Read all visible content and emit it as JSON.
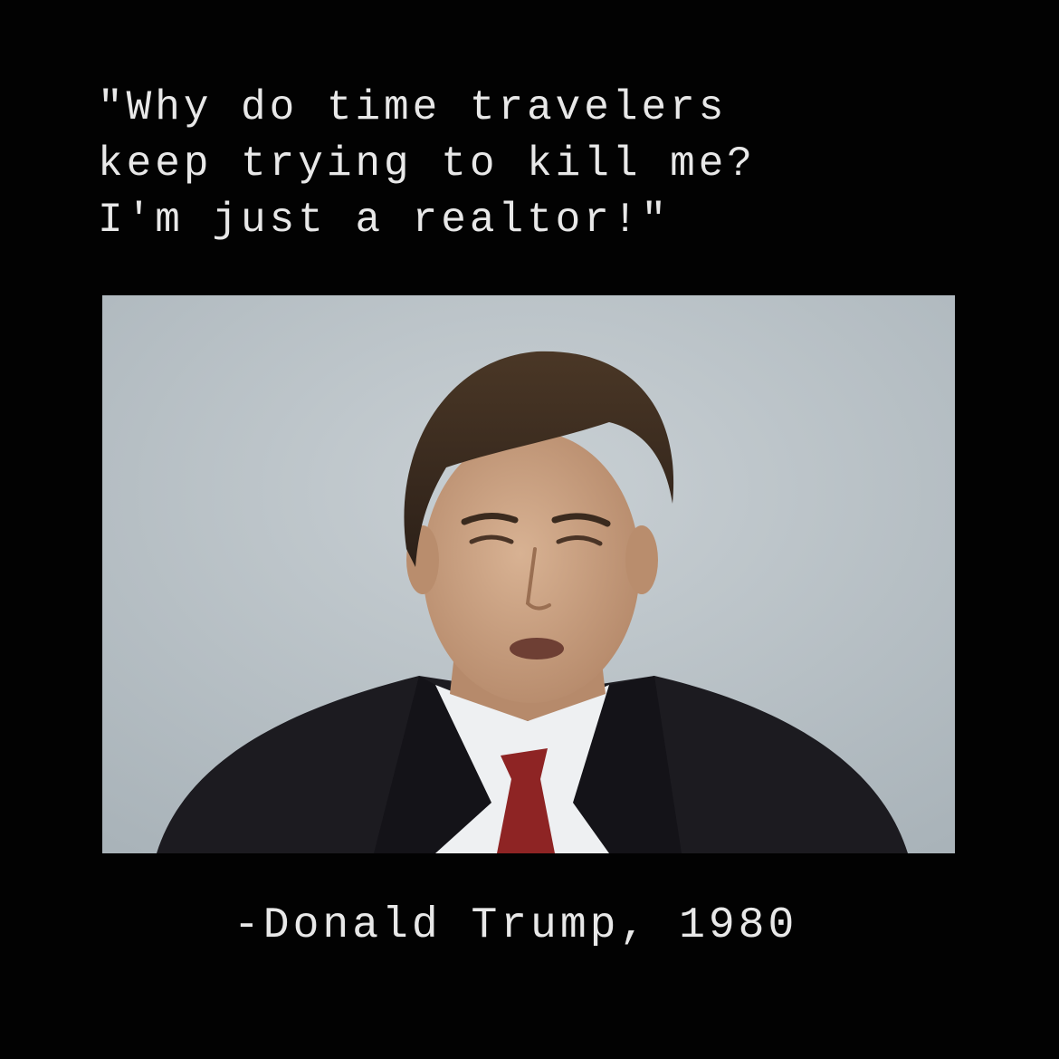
{
  "meme": {
    "quote_lines": [
      "\"Why do time travelers",
      "keep trying to kill me?",
      "I'm just a realtor!\""
    ],
    "attribution": "-Donald Trump, 1980",
    "photo_subject": "man-in-suit-portrait"
  },
  "colors": {
    "background": "#020202",
    "text": "#e8e8e8",
    "photo_backdrop": "#b9c2c8",
    "suit": "#1c1b20",
    "shirt": "#eef0f2",
    "tie": "#8e2424",
    "hair": "#3a2a1e",
    "skin": "#caa283"
  }
}
